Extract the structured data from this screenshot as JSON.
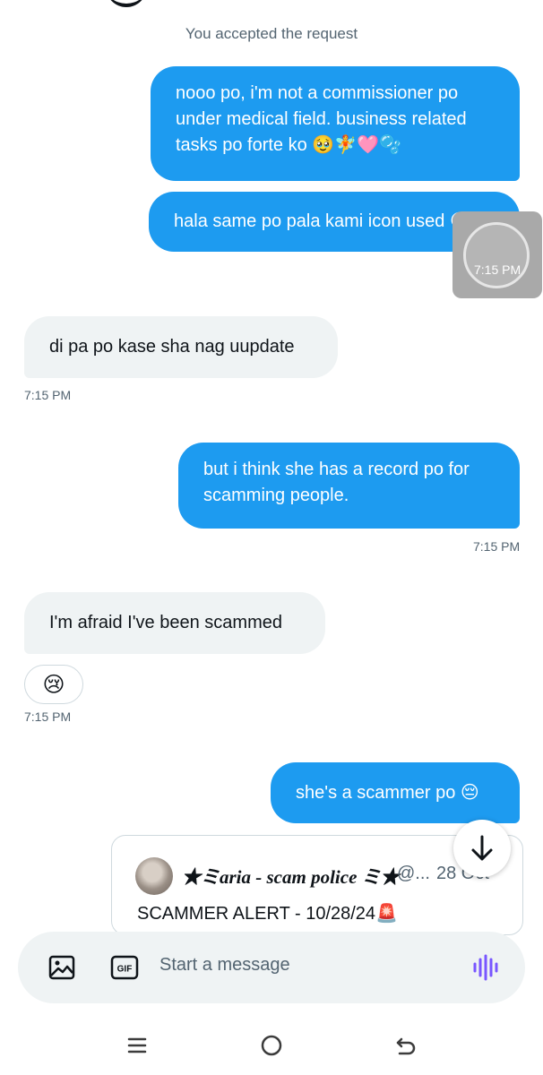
{
  "conversation": {
    "system_note": "You accepted the request",
    "messages": [
      {
        "id": "m1",
        "direction": "out",
        "text": "nooo po, i'm not a commissioner po under medical field. business related tasks po forte ko 🥹🧚🩷🫧"
      },
      {
        "id": "m2",
        "direction": "out",
        "text": "hala same po pala kami icon used 😔",
        "time": "7:15 PM"
      },
      {
        "id": "m3",
        "direction": "in",
        "text": "di pa po kase sha nag uupdate",
        "time": "7:15 PM"
      },
      {
        "id": "m4",
        "direction": "out",
        "text": "but i think she has a record po for scamming people.",
        "time": "7:15 PM"
      },
      {
        "id": "m5",
        "direction": "in",
        "text": "I'm afraid I've been scammed",
        "reaction": "😢",
        "time": "7:15 PM"
      },
      {
        "id": "m6",
        "direction": "out",
        "text": "she's a scammer po 😔"
      }
    ],
    "shared_post": {
      "author_name": "★ミaria - scam police ミ★",
      "handle": "@...",
      "date": "28 Oct",
      "text": "SCAMMER ALERT - 10/28/24🚨"
    }
  },
  "composer": {
    "placeholder": "Start a message",
    "accent_color": "#7856ff"
  },
  "colors": {
    "outgoing_bubble": "#1d9bf0",
    "incoming_bubble": "#eff3f4",
    "secondary_text": "#536471"
  },
  "icons": [
    "image-icon",
    "gif-icon",
    "voice-icon",
    "arrow-down-icon",
    "menu-icon",
    "home-icon",
    "back-icon"
  ]
}
